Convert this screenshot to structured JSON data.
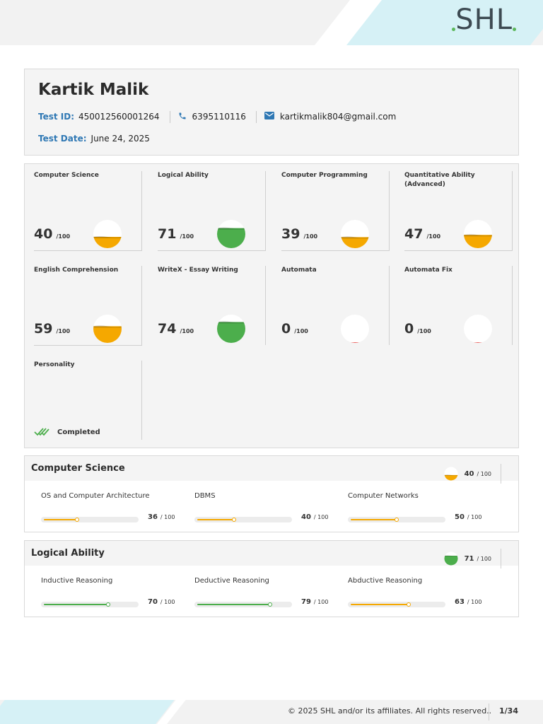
{
  "brand": {
    "logo": "SHL",
    "accent": "#2f78b4",
    "green": "#4cae4c",
    "orange": "#f5a800",
    "red": "#e53935"
  },
  "candidate": {
    "name": "Kartik Malik",
    "test_id_label": "Test ID:",
    "test_id": "450012560001264",
    "phone": "6395110116",
    "email": "kartikmalik804@gmail.com",
    "test_date_label": "Test Date:",
    "test_date": "June 24, 2025"
  },
  "tiles": [
    {
      "title": "Computer Science",
      "score": "40",
      "of": "/100",
      "level": 0.4,
      "color": "#f5a800"
    },
    {
      "title": "Logical Ability",
      "score": "71",
      "of": "/100",
      "level": 0.71,
      "color": "#4cae4c"
    },
    {
      "title": "Computer Programming",
      "score": "39",
      "of": "/100",
      "level": 0.39,
      "color": "#f5a800"
    },
    {
      "title": "Quantitative Ability (Advanced)",
      "score": "47",
      "of": "/100",
      "level": 0.47,
      "color": "#f5a800"
    },
    {
      "title": "English Comprehension",
      "score": "59",
      "of": "/100",
      "level": 0.59,
      "color": "#f5a800"
    },
    {
      "title": "WriteX - Essay Writing",
      "score": "74",
      "of": "/100",
      "level": 0.74,
      "color": "#4cae4c"
    },
    {
      "title": "Automata",
      "score": "0",
      "of": "/100",
      "level": 0.0,
      "color": "#e53935"
    },
    {
      "title": "Automata Fix",
      "score": "0",
      "of": "/100",
      "level": 0.0,
      "color": "#e53935"
    }
  ],
  "personality": {
    "title": "Personality",
    "status": "Completed"
  },
  "sections": [
    {
      "title": "Computer Science",
      "score": "40",
      "of": "/ 100",
      "level": 0.4,
      "color": "#f5a800",
      "subs": [
        {
          "name": "OS and Computer Architecture",
          "score": "36",
          "of": "/ 100",
          "level": 0.36,
          "color": "#f5a800"
        },
        {
          "name": "DBMS",
          "score": "40",
          "of": "/ 100",
          "level": 0.4,
          "color": "#f5a800"
        },
        {
          "name": "Computer Networks",
          "score": "50",
          "of": "/ 100",
          "level": 0.5,
          "color": "#f5a800"
        }
      ]
    },
    {
      "title": "Logical Ability",
      "score": "71",
      "of": "/ 100",
      "level": 0.71,
      "color": "#4cae4c",
      "subs": [
        {
          "name": "Inductive Reasoning",
          "score": "70",
          "of": "/ 100",
          "level": 0.7,
          "color": "#4cae4c"
        },
        {
          "name": "Deductive Reasoning",
          "score": "79",
          "of": "/ 100",
          "level": 0.79,
          "color": "#4cae4c"
        },
        {
          "name": "Abductive Reasoning",
          "score": "63",
          "of": "/ 100",
          "level": 0.63,
          "color": "#f5a800"
        }
      ]
    }
  ],
  "footer": {
    "copyright": "© 2025 SHL and/or its affiliates. All rights reserved..",
    "page": "1/34"
  }
}
